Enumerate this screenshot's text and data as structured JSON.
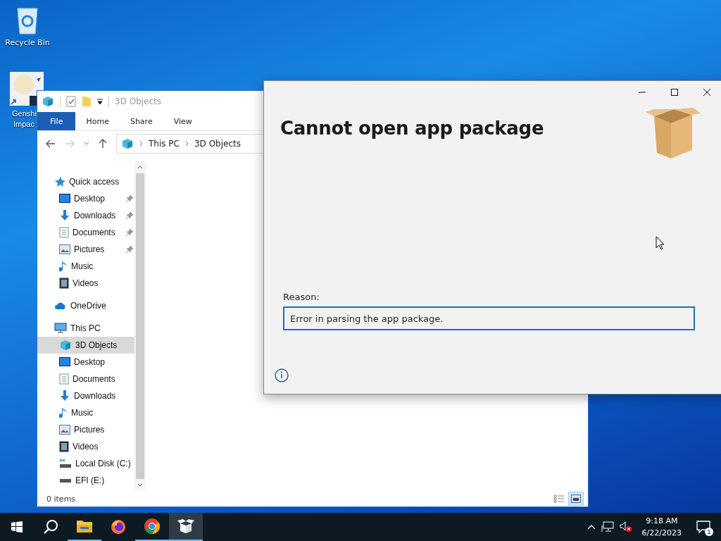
{
  "desktop_icons": [
    {
      "kind": "recycle",
      "label": "Recycle Bin"
    },
    {
      "kind": "app",
      "label_lines": [
        "Genshi",
        "Impac"
      ]
    }
  ],
  "explorer": {
    "title": "3D Objects",
    "ribbon_tabs": [
      {
        "label": "File",
        "selected": true
      },
      {
        "label": "Home",
        "selected": false
      },
      {
        "label": "Share",
        "selected": false
      },
      {
        "label": "View",
        "selected": false
      }
    ],
    "breadcrumb": [
      "This PC",
      "3D Objects"
    ],
    "nav": [
      {
        "kind": "star",
        "label": "Quick access",
        "selected": false,
        "children": [
          {
            "kind": "desktop",
            "label": "Desktop",
            "pinned": true,
            "selected": false
          },
          {
            "kind": "downloads",
            "label": "Downloads",
            "pinned": true,
            "selected": false
          },
          {
            "kind": "documents",
            "label": "Documents",
            "pinned": true,
            "selected": false
          },
          {
            "kind": "pictures",
            "label": "Pictures",
            "pinned": true,
            "selected": false
          },
          {
            "kind": "music",
            "label": "Music",
            "pinned": false,
            "selected": false
          },
          {
            "kind": "videos",
            "label": "Videos",
            "pinned": false,
            "selected": false
          }
        ]
      },
      {
        "kind": "cloud",
        "label": "OneDrive",
        "selected": false
      },
      {
        "kind": "pc",
        "label": "This PC",
        "selected": false,
        "children": [
          {
            "kind": "cube",
            "label": "3D Objects",
            "pinned": false,
            "selected": true
          },
          {
            "kind": "desktop",
            "label": "Desktop",
            "pinned": false,
            "selected": false
          },
          {
            "kind": "documents",
            "label": "Documents",
            "pinned": false,
            "selected": false
          },
          {
            "kind": "downloads",
            "label": "Downloads",
            "pinned": false,
            "selected": false
          },
          {
            "kind": "music",
            "label": "Music",
            "pinned": false,
            "selected": false
          },
          {
            "kind": "pictures",
            "label": "Pictures",
            "pinned": false,
            "selected": false
          },
          {
            "kind": "videos",
            "label": "Videos",
            "pinned": false,
            "selected": false
          },
          {
            "kind": "disk",
            "label": "Local Disk (C:)",
            "pinned": false,
            "selected": false
          },
          {
            "kind": "drive",
            "label": "EFI (E:)",
            "pinned": false,
            "selected": false
          }
        ]
      }
    ],
    "status": "0 items",
    "view_buttons": [
      {
        "kind": "details",
        "selected": false
      },
      {
        "kind": "large",
        "selected": true
      }
    ]
  },
  "dialog": {
    "title": "Cannot open app package",
    "reason_label": "Reason:",
    "reason": "Error in parsing the app package."
  },
  "taskbar": {
    "apps": [
      {
        "kind": "explorer",
        "running": true,
        "active": false
      },
      {
        "kind": "firefox",
        "running": false,
        "active": false
      },
      {
        "kind": "chrome",
        "running": true,
        "active": false
      },
      {
        "kind": "installer",
        "running": true,
        "active": true
      }
    ],
    "time": "9:18 AM",
    "date": "6/22/2023",
    "notification_count": "1"
  }
}
